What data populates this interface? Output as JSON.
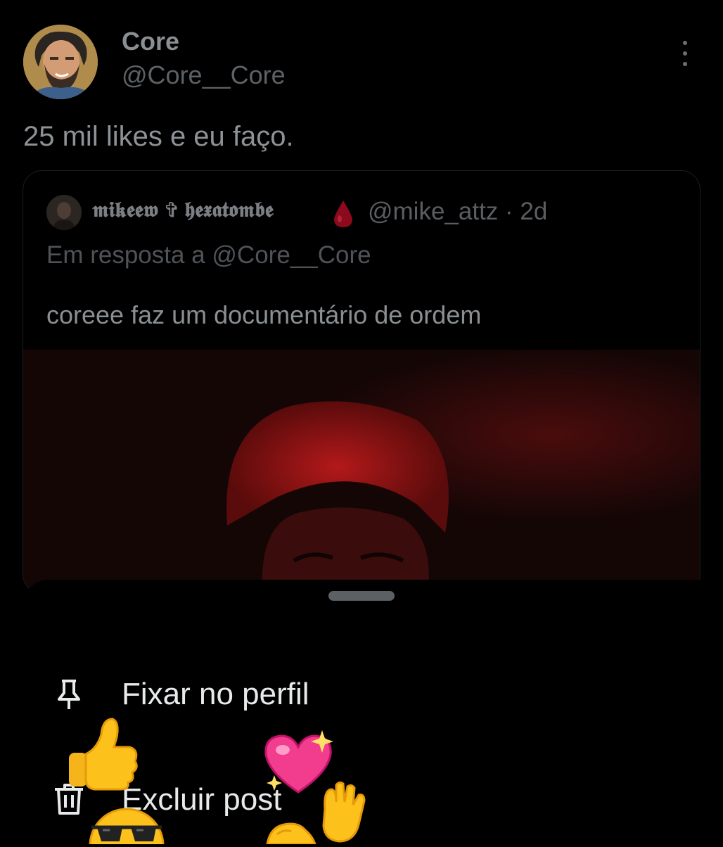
{
  "post": {
    "author_name": "Core",
    "author_handle": "@Core__Core",
    "text": "25 mil likes e eu faço."
  },
  "quoted": {
    "author_name": "𝖒𝖎𝖐𝖊𝖊𝖜 ✞ 𝖍𝖊𝖝𝖆𝖙𝖔𝖒𝖇𝖊",
    "handle_time": "@mike_attz · 2d",
    "reply_prefix": "Em resposta a",
    "reply_handle": "@Core__Core",
    "text": "coreee faz um documentário de ordem"
  },
  "menu": {
    "items": [
      {
        "label": "Fixar no perfil",
        "icon": "pin-icon"
      },
      {
        "label": "Excluir post",
        "icon": "trash-icon"
      }
    ]
  },
  "stickers": [
    "thumbs-up-emoji",
    "sparkling-heart-emoji",
    "raised-hand-emoji",
    "sunglasses-face-emoji",
    "waving-hand-emoji"
  ],
  "colors": {
    "background": "#000000",
    "text_primary": "#e7e9ea",
    "text_dimmed": "#5d6266",
    "accent_red": "#c8102e"
  }
}
